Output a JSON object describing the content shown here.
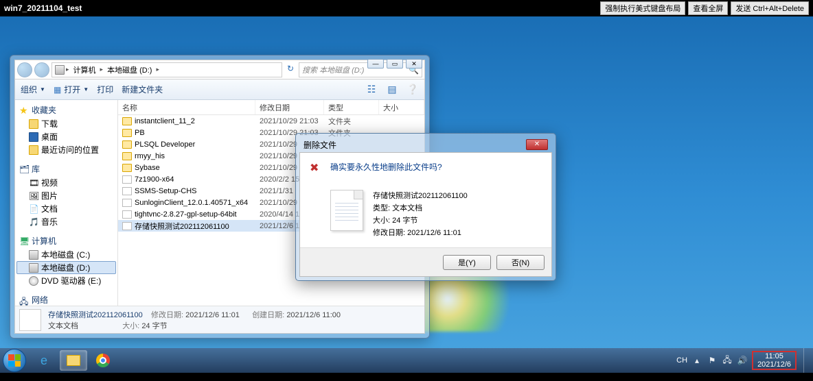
{
  "vnc": {
    "title": "win7_20211104_test",
    "btn_layout": "强制执行美式键盘布局",
    "btn_fullscreen": "查看全屏",
    "btn_cad": "发送 Ctrl+Alt+Delete"
  },
  "explorer": {
    "breadcrumb": {
      "seg1": "计算机",
      "seg2": "本地磁盘 (D:)"
    },
    "search_placeholder": "搜索 本地磁盘 (D:)",
    "toolbar": {
      "organize": "组织",
      "open": "打开",
      "print": "打印",
      "newfolder": "新建文件夹"
    },
    "nav": {
      "favorites": "收藏夹",
      "downloads": "下载",
      "desktop": "桌面",
      "recent": "最近访问的位置",
      "libraries": "库",
      "videos": "视频",
      "pictures": "图片",
      "documents": "文档",
      "music": "音乐",
      "computer": "计算机",
      "cdrive": "本地磁盘 (C:)",
      "ddrive": "本地磁盘 (D:)",
      "edrive": "DVD 驱动器 (E:)",
      "network": "网络"
    },
    "columns": {
      "name": "名称",
      "date": "修改日期",
      "type": "类型",
      "size": "大小"
    },
    "files": [
      {
        "name": "instantclient_11_2",
        "date": "2021/10/29 21:03",
        "type": "文件夹",
        "icon": "folder"
      },
      {
        "name": "PB",
        "date": "2021/10/29 21:03",
        "type": "文件夹",
        "icon": "folder"
      },
      {
        "name": "PLSQL Developer",
        "date": "2021/10/29",
        "type": "",
        "icon": "folder"
      },
      {
        "name": "rmyy_his",
        "date": "2021/10/29",
        "type": "",
        "icon": "folder"
      },
      {
        "name": "Sybase",
        "date": "2021/10/29",
        "type": "",
        "icon": "folder"
      },
      {
        "name": "7z1900-x64",
        "date": "2020/2/2 15",
        "type": "",
        "icon": "file"
      },
      {
        "name": "SSMS-Setup-CHS",
        "date": "2021/1/31",
        "type": "",
        "icon": "file"
      },
      {
        "name": "SunloginClient_12.0.1.40571_x64",
        "date": "2021/10/29",
        "type": "",
        "icon": "file"
      },
      {
        "name": "tightvnc-2.8.27-gpl-setup-64bit",
        "date": "2020/4/14 1",
        "type": "",
        "icon": "file"
      },
      {
        "name": "存储快照测试202112061100",
        "date": "2021/12/6 1",
        "type": "",
        "icon": "txt",
        "selected": true
      }
    ],
    "details": {
      "name": "存储快照测试202112061100",
      "type": "文本文档",
      "mod_label": "修改日期:",
      "mod_value": "2021/12/6 11:01",
      "size_label": "大小:",
      "size_value": "24 字节",
      "created_label": "创建日期:",
      "created_value": "2021/12/6 11:00"
    }
  },
  "dialog": {
    "title": "删除文件",
    "message": "确实要永久性地删除此文件吗?",
    "file": {
      "name": "存储快照测试202112061100",
      "type_label": "类型:",
      "type_value": "文本文档",
      "size_label": "大小:",
      "size_value": "24 字节",
      "mod_label": "修改日期:",
      "mod_value": "2021/12/6 11:01"
    },
    "yes": "是(Y)",
    "no": "否(N)"
  },
  "taskbar": {
    "ime": "CH",
    "time": "11:05",
    "date": "2021/12/6"
  }
}
